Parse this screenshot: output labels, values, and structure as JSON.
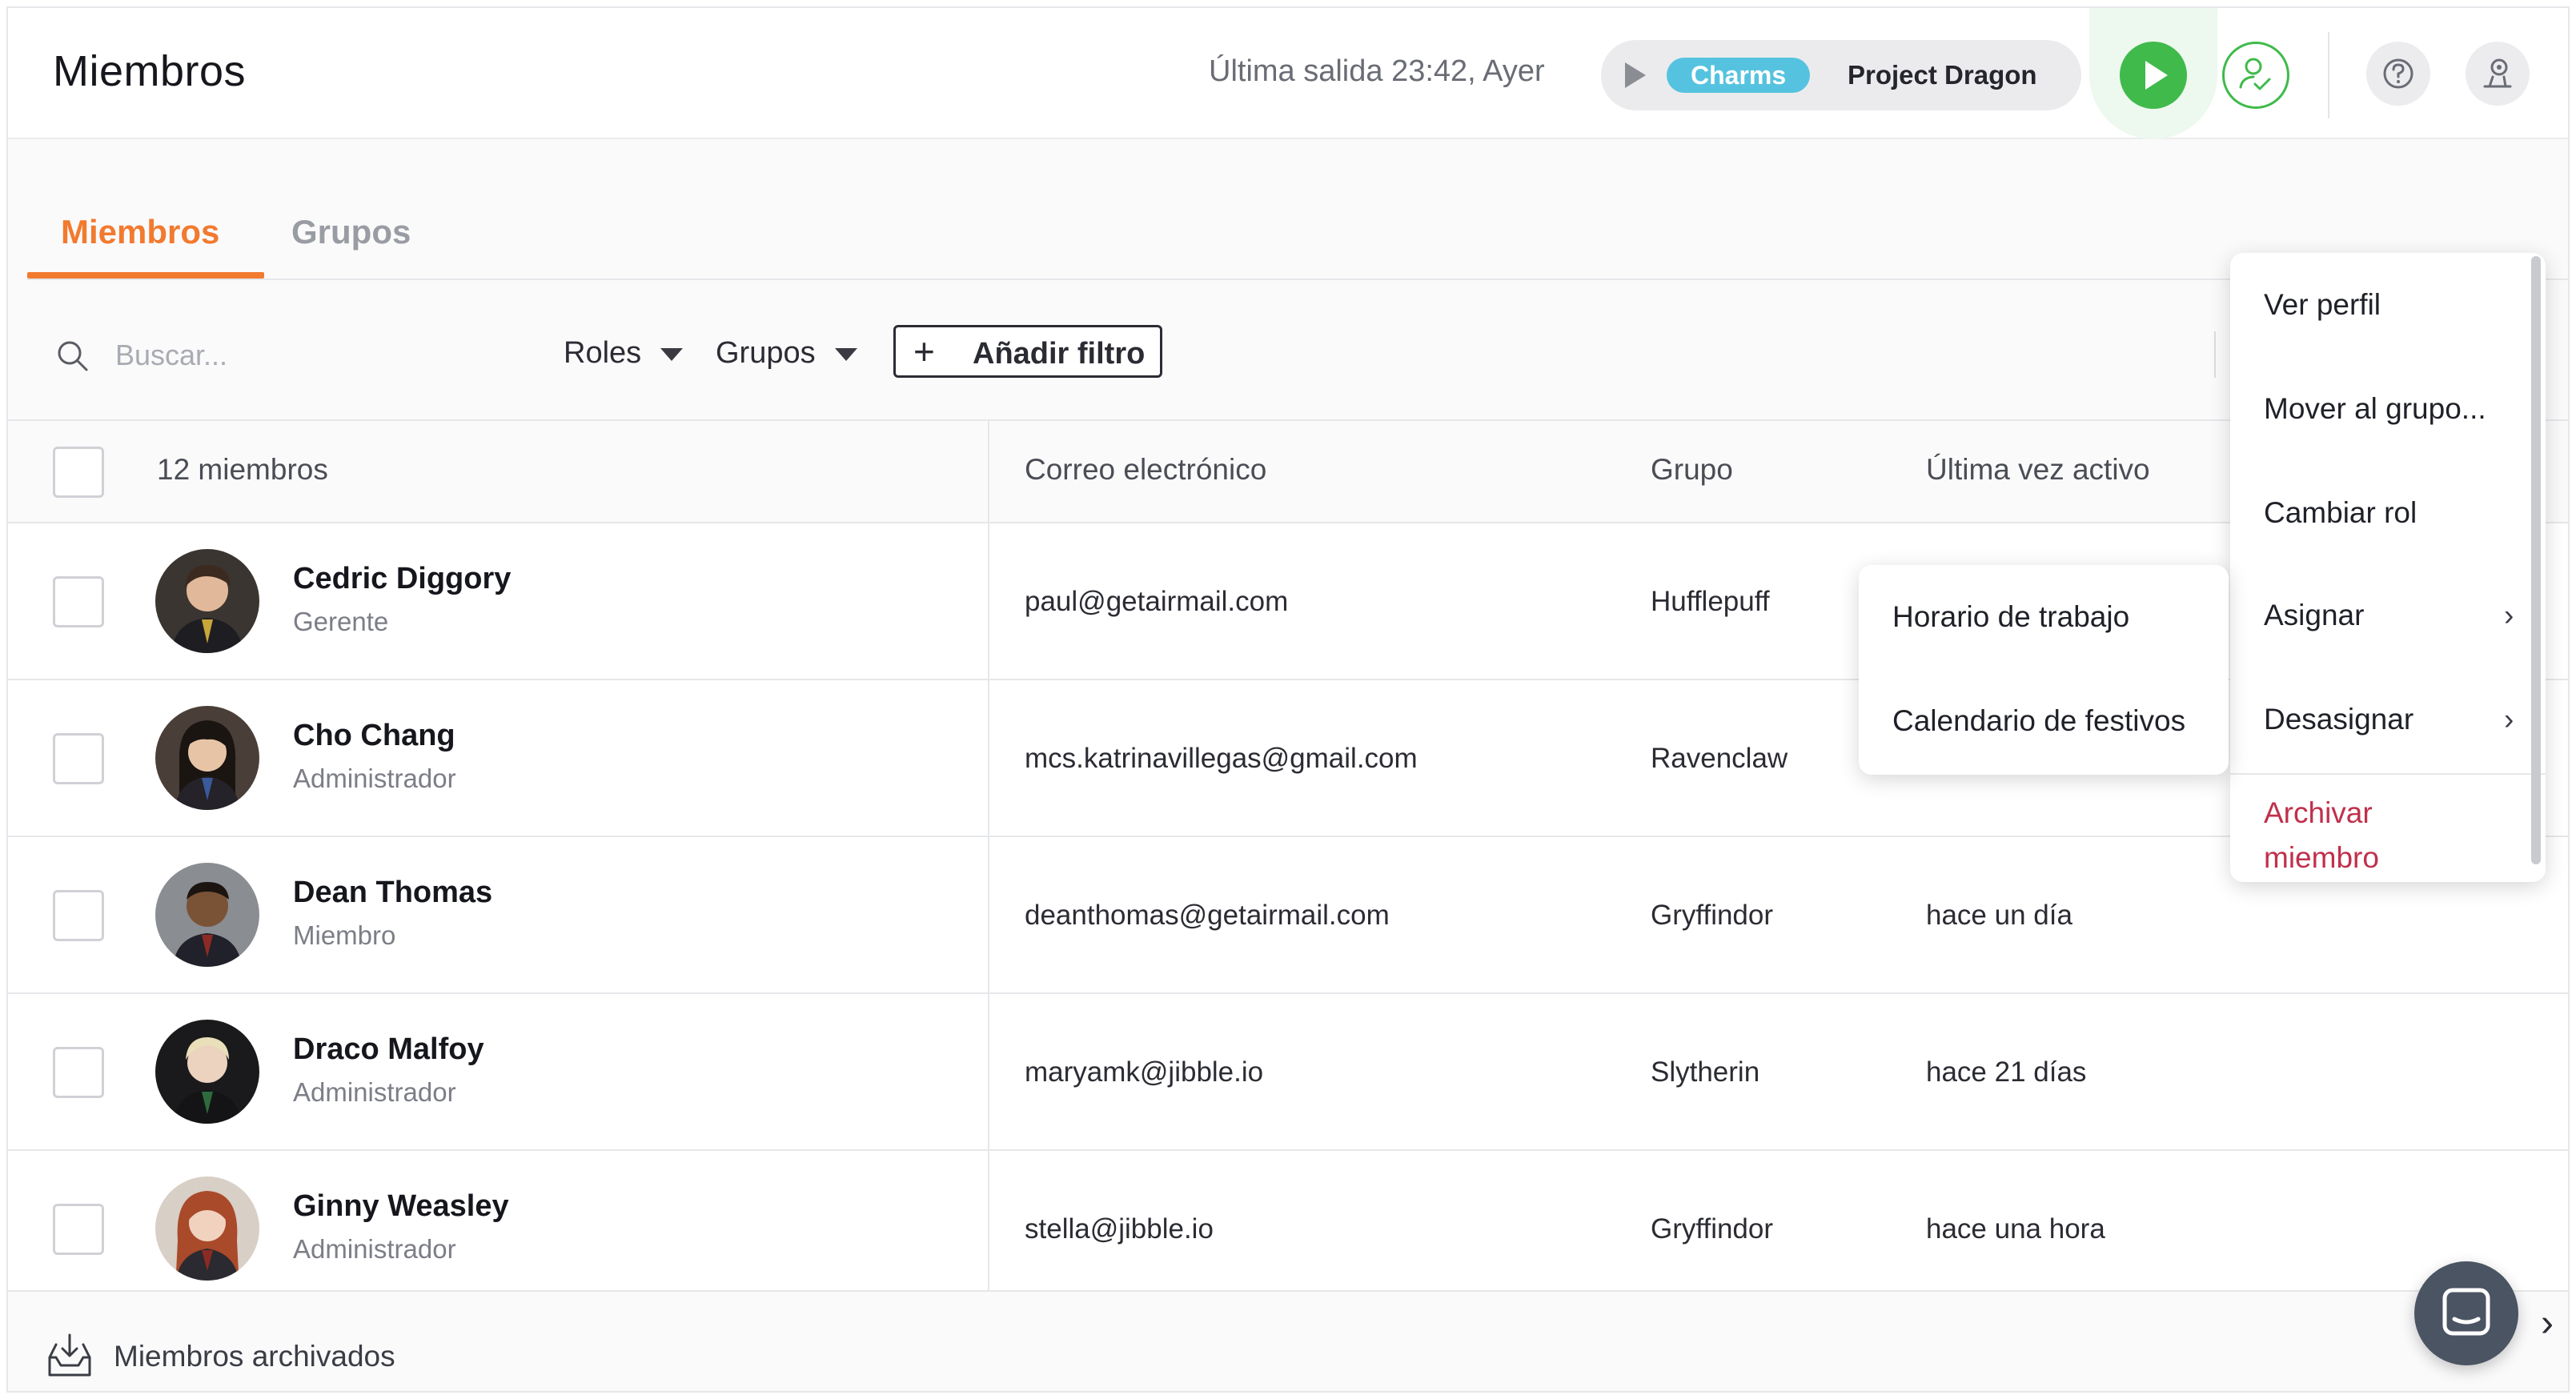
{
  "header": {
    "title": "Miembros",
    "last_out": "Última salida 23:42, Ayer",
    "timer_tag": "Charms",
    "timer_project": "Project Dragon",
    "accent_green": "#3fba4b"
  },
  "tabs": [
    {
      "label": "Miembros",
      "active": true
    },
    {
      "label": "Grupos",
      "active": false
    }
  ],
  "accent_orange": "#f27a2f",
  "filters": {
    "search_placeholder": "Buscar...",
    "roles": "Roles",
    "groups": "Grupos",
    "add_filter": "Añadir filtro"
  },
  "table": {
    "count_label": "12 miembros",
    "columns": {
      "email": "Correo electrónico",
      "group": "Grupo",
      "last_active": "Última vez activo"
    },
    "rows": [
      {
        "name": "Cedric Diggory",
        "role": "Gerente",
        "email": "paul@getairmail.com",
        "group": "Hufflepuff",
        "last_active": ""
      },
      {
        "name": "Cho Chang",
        "role": "Administrador",
        "email": "mcs.katrinavillegas@gmail.com",
        "group": "Ravenclaw",
        "last_active": ""
      },
      {
        "name": "Dean Thomas",
        "role": "Miembro",
        "email": "deanthomas@getairmail.com",
        "group": "Gryffindor",
        "last_active": "hace un día"
      },
      {
        "name": "Draco Malfoy",
        "role": "Administrador",
        "email": "maryamk@jibble.io",
        "group": "Slytherin",
        "last_active": "hace 21 días"
      },
      {
        "name": "Ginny Weasley",
        "role": "Administrador",
        "email": "stella@jibble.io",
        "group": "Gryffindor",
        "last_active": "hace una hora"
      }
    ]
  },
  "footer": {
    "archived": "Miembros archivados"
  },
  "context_menu": {
    "view_profile": "Ver perfil",
    "move_to_group": "Mover al grupo...",
    "change_role": "Cambiar rol",
    "assign": "Asignar",
    "unassign": "Desasignar",
    "archive_line1": "Archivar",
    "archive_line2": "miembro",
    "danger_color": "#c0304c"
  },
  "submenu": {
    "work_schedule": "Horario de trabajo",
    "holiday_calendar": "Calendario de festivos"
  }
}
